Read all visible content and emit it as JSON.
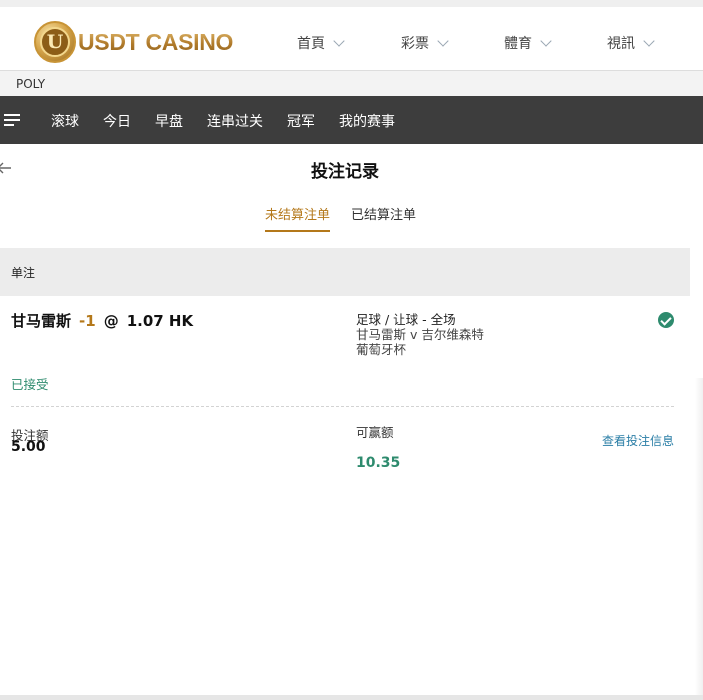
{
  "header": {
    "logo_text": "USDT CASINO",
    "logo_letter": "U",
    "nav": [
      {
        "label": "首頁"
      },
      {
        "label": "彩票"
      },
      {
        "label": "體育"
      },
      {
        "label": "視訊"
      }
    ]
  },
  "provider": {
    "label": "POLY"
  },
  "sports_nav": {
    "items": [
      {
        "label": "滚球"
      },
      {
        "label": "今日"
      },
      {
        "label": "早盘"
      },
      {
        "label": "连串过关"
      },
      {
        "label": "冠军"
      },
      {
        "label": "我的赛事"
      }
    ]
  },
  "page": {
    "title": "投注记录",
    "tabs": [
      {
        "label": "未结算注单",
        "active": true
      },
      {
        "label": "已结算注单",
        "active": false
      }
    ]
  },
  "section": {
    "label": "单注"
  },
  "bet": {
    "selection": "甘马雷斯",
    "handicap": "-1",
    "at": "@",
    "odds": "1.07 HK",
    "market": "足球 / 让球 - 全场",
    "match": "甘马雷斯 v 吉尔维森特",
    "league": "葡萄牙杯",
    "status": "已接受",
    "stake_label": "投注额",
    "stake_value": "5.00",
    "win_label": "可赢额",
    "win_value": "10.35",
    "details_link": "查看投注信息"
  },
  "colors": {
    "accent_gold": "#b4781a",
    "success_green": "#2e8b6e",
    "link_blue": "#2a7ea6",
    "sports_bar_bg": "#3d3d3d"
  }
}
